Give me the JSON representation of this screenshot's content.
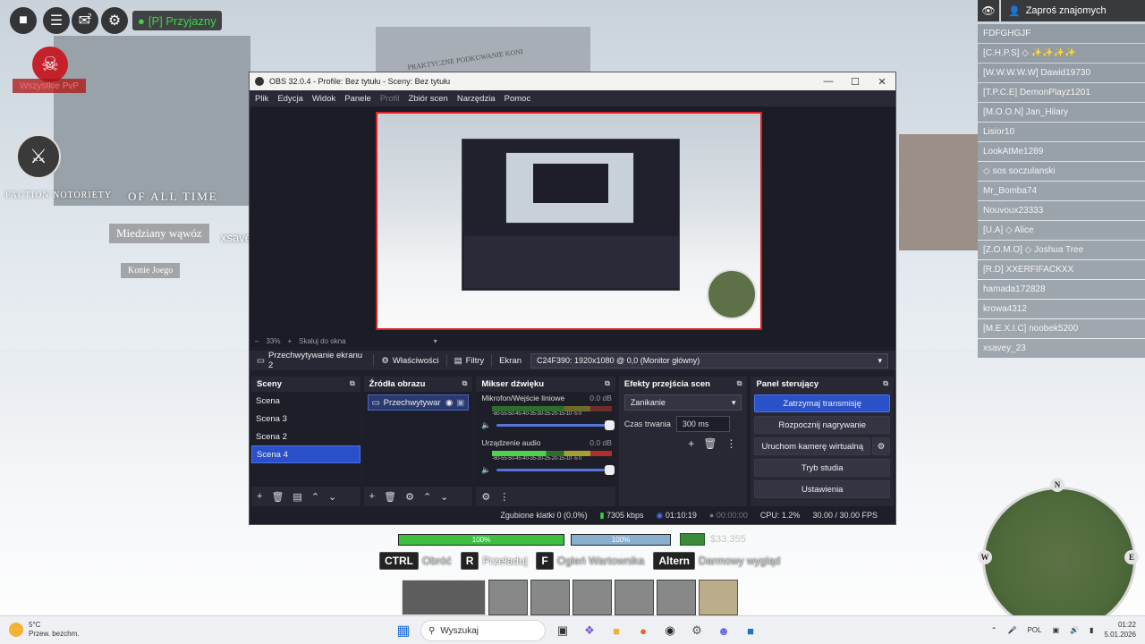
{
  "game": {
    "toolbar": {
      "team_label": "[P] Przyjazny",
      "chat_badge": "2"
    },
    "kill_label": "Wszystkie PvP",
    "board": {
      "faction_notoriety": "FACTION NOTORIETY",
      "of_all_time": "OF ALL TIME",
      "sign_wawoz": "Miedziany wąwóz",
      "sign_konie": "Konie Joego",
      "player_tag": "xsave",
      "banner": "PRAKTYCZNE PODKUWANIE KONI"
    },
    "player_list": {
      "invite_label": "Zaproś znajomych",
      "players": [
        "FDFGHGJF",
        "[C.H.P.S] ◇ ✨✨✨✨",
        "[W.W.W.W.W] Dawid19730",
        "[T.P.C.E] DemonPlayz1201",
        "[M.O.O.N] Jan_Hilary",
        "Lisior10",
        "LookAtMe1289",
        "◇ sos soczulanski",
        "Mr_Bomba74",
        "Nouvoux23333",
        "[U.A] ◇ Alice",
        "[Z.O.M.O] ◇ Joshua Tree",
        "[R.D] XXERFIFACKXX",
        "hamada172828",
        "krowa4312",
        "[M.E.X.I.C] noobek5200",
        "xsavey_23"
      ]
    },
    "hud": {
      "health_pct": "100%",
      "stamina_pct": "100%",
      "health_fill": 1.0,
      "stamina_fill": 1.0,
      "money": "$33,355",
      "keys": [
        {
          "key": "CTRL",
          "label": "Obróć",
          "dim": true
        },
        {
          "key": "R",
          "label": "Przeładuj",
          "dim": false
        },
        {
          "key": "F",
          "label": "Ogleń Wartownika",
          "dim": true
        },
        {
          "key": "Altern",
          "label": "Darmowy wygląd",
          "dim": true
        }
      ]
    },
    "minimap": {
      "n": "N",
      "w": "W",
      "e": "E"
    }
  },
  "obs": {
    "title": "OBS 32.0.4 - Profile: Bez tytułu - Sceny: Bez tytułu",
    "menu": [
      "Plik",
      "Edycja",
      "Widok",
      "Panele",
      "Profil",
      "Zbiór scen",
      "Narzędzia",
      "Pomoc"
    ],
    "menu_disabled": "Profil",
    "zoom": "33%",
    "scale_label": "Skaluj do okna",
    "source_name": "Przechwytywanie ekranu 2",
    "properties_label": "Właściwości",
    "filters_label": "Filtry",
    "screen_label": "Ekran",
    "screen_value": "C24F390: 1920x1080 @ 0,0 (Monitor główny)",
    "scenes": {
      "title": "Sceny",
      "items": [
        "Scena",
        "Scena 3",
        "Scena 2",
        "Scena 4"
      ],
      "active_index": 3
    },
    "sources": {
      "title": "Źródła obrazu",
      "items": [
        "Przechwytywar"
      ]
    },
    "mixer": {
      "title": "Mikser dźwięku",
      "ticks": "-60-55-50-45-40-35-30-25-20-15-10 -5 0",
      "channels": [
        {
          "name": "Mikrofon/Wejście liniowe",
          "db": "0.0 dB"
        },
        {
          "name": "Urządzenie audio",
          "db": "0.0 dB"
        }
      ]
    },
    "transitions": {
      "title": "Efekty przejścia scen",
      "selected": "Zanikanie",
      "duration_label": "Czas trwania",
      "duration_value": "300 ms"
    },
    "controls": {
      "title": "Panel sterujący",
      "stop_stream": "Zatrzymaj transmisję",
      "start_recording": "Rozpocznij nagrywanie",
      "virtual_cam": "Uruchom kamerę wirtualną",
      "studio_mode": "Tryb studia",
      "settings": "Ustawienia"
    },
    "status": {
      "dropped": "Zgubione klatki 0 (0.0%)",
      "bitrate": "7305 kbps",
      "stream_time": "01:10:19",
      "rec_time": "00:00:00",
      "cpu": "CPU: 1.2%",
      "fps": "30.00 / 30.00 FPS"
    }
  },
  "taskbar": {
    "weather_temp": "5°C",
    "weather_desc": "Przew. bezchm.",
    "search_placeholder": "Wyszukaj",
    "lang": "POL",
    "time": "01:22",
    "date": "5.01.2026"
  },
  "colors": {
    "obs_accent": "#2a51c9",
    "preview_border": "#e02020",
    "team_green": "#3fd24a"
  }
}
